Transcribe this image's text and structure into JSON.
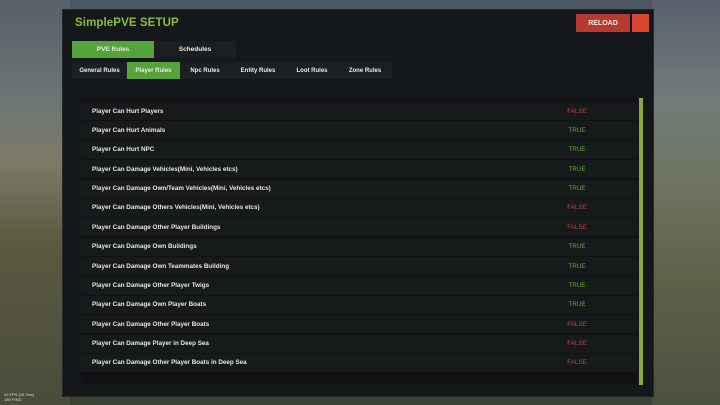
{
  "window": {
    "title": "SimplePVE SETUP",
    "reload_label": "RELOAD"
  },
  "main_tabs": [
    {
      "label": "PVE Rules",
      "active": true
    },
    {
      "label": "Schedules",
      "active": false
    }
  ],
  "sub_tabs": [
    {
      "label": "General Rules",
      "active": false
    },
    {
      "label": "Player Rules",
      "active": true
    },
    {
      "label": "Npc Rules",
      "active": false
    },
    {
      "label": "Entity Rules",
      "active": false
    },
    {
      "label": "Loot Rules",
      "active": false
    },
    {
      "label": "Zone Rules",
      "active": false
    }
  ],
  "rules": [
    {
      "label": "Player Can Hurt Players",
      "value": "FALSE"
    },
    {
      "label": "Player Can Hurt Animals",
      "value": "TRUE"
    },
    {
      "label": "Player Can Hurt NPC",
      "value": "TRUE"
    },
    {
      "label": "Player Can Damage Vehicles(Mini, Vehicles etcs)",
      "value": "TRUE"
    },
    {
      "label": "Player Can Damage Own/Team Vehicles(Mini, Vehicles etcs)",
      "value": "TRUE"
    },
    {
      "label": "Player Can Damage Others Vehicles(Mini, Vehicles etcs)",
      "value": "FALSE"
    },
    {
      "label": "Player Can Damage Other Player Buildings",
      "value": "FALSE"
    },
    {
      "label": "Player Can Damage Own Buildings",
      "value": "TRUE"
    },
    {
      "label": "Player Can Damage Own Teammates Building",
      "value": "TRUE"
    },
    {
      "label": "Player Can Damage Other Player Twigs",
      "value": "TRUE"
    },
    {
      "label": "Player Can Damage Own Player Boats",
      "value": "TRUE"
    },
    {
      "label": "Player Can Damage Other Player Boats",
      "value": "FALSE"
    },
    {
      "label": "Player Can Damage Player in Deep Sea",
      "value": "FALSE"
    },
    {
      "label": "Player Can Damage Other Player Boats in Deep Sea",
      "value": "FALSE"
    }
  ],
  "hud": {
    "fps": "49 FPS (20.3ms)",
    "ping": "185 PING"
  },
  "colors": {
    "accent": "#55a43b",
    "title": "#8dbb3a",
    "true": "#5fae33",
    "false": "#cc3b32",
    "reload": "#b63a30"
  }
}
